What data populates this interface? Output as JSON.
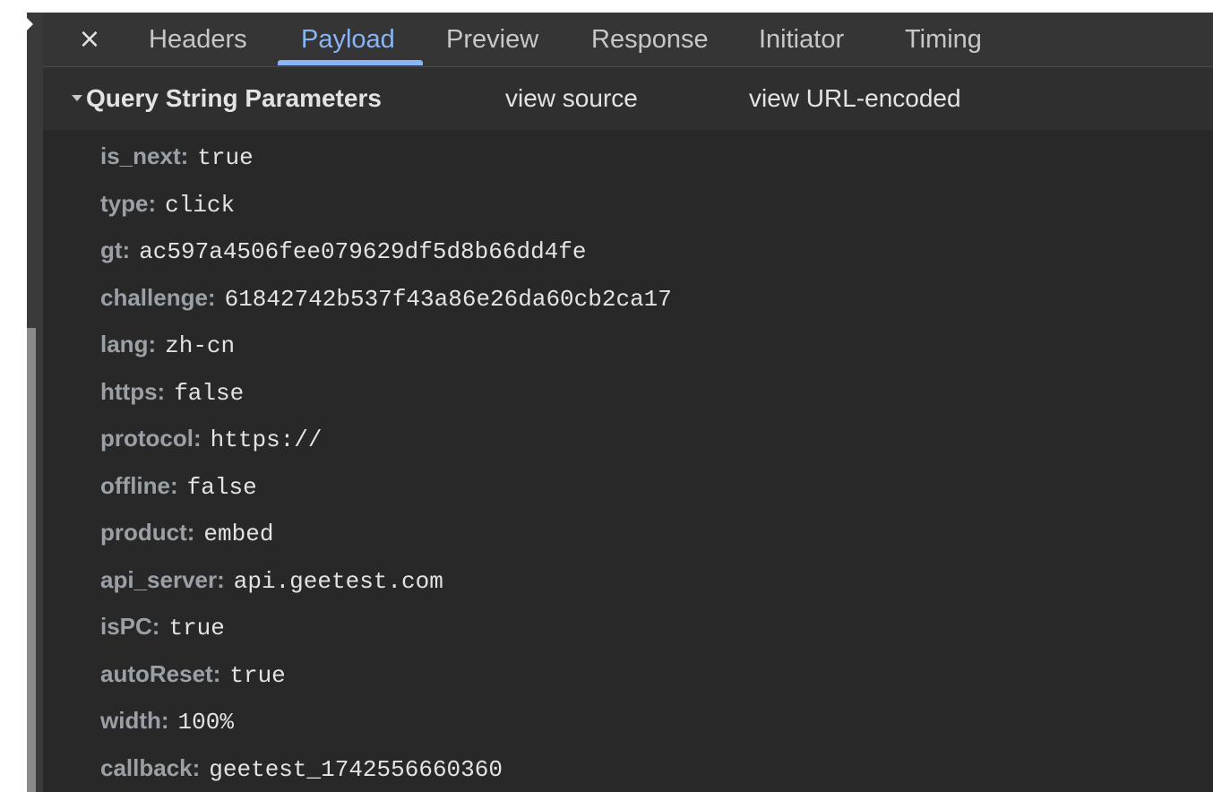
{
  "tabs": {
    "close_symbol": "×",
    "items": [
      {
        "label": "Headers"
      },
      {
        "label": "Payload"
      },
      {
        "label": "Preview"
      },
      {
        "label": "Response"
      },
      {
        "label": "Initiator"
      },
      {
        "label": "Timing"
      }
    ],
    "active": "Payload"
  },
  "section": {
    "title": "Query String Parameters",
    "view_source": "view source",
    "view_encoded": "view URL-encoded"
  },
  "params": [
    {
      "key": "is_next:",
      "value": "true"
    },
    {
      "key": "type:",
      "value": "click"
    },
    {
      "key": "gt:",
      "value": "ac597a4506fee079629df5d8b66dd4fe"
    },
    {
      "key": "challenge:",
      "value": "61842742b537f43a86e26da60cb2ca17"
    },
    {
      "key": "lang:",
      "value": "zh-cn"
    },
    {
      "key": "https:",
      "value": "false"
    },
    {
      "key": "protocol:",
      "value": "https://"
    },
    {
      "key": "offline:",
      "value": "false"
    },
    {
      "key": "product:",
      "value": "embed"
    },
    {
      "key": "api_server:",
      "value": "api.geetest.com"
    },
    {
      "key": "isPC:",
      "value": "true"
    },
    {
      "key": "autoReset:",
      "value": "true"
    },
    {
      "key": "width:",
      "value": "100%"
    },
    {
      "key": "callback:",
      "value": "geetest_1742556660360"
    }
  ],
  "colors": {
    "background": "#282828",
    "tabbar": "#353535",
    "accent": "#8ab4f8",
    "key_text": "#9aa0a6",
    "value_text": "#e3e3e3"
  }
}
